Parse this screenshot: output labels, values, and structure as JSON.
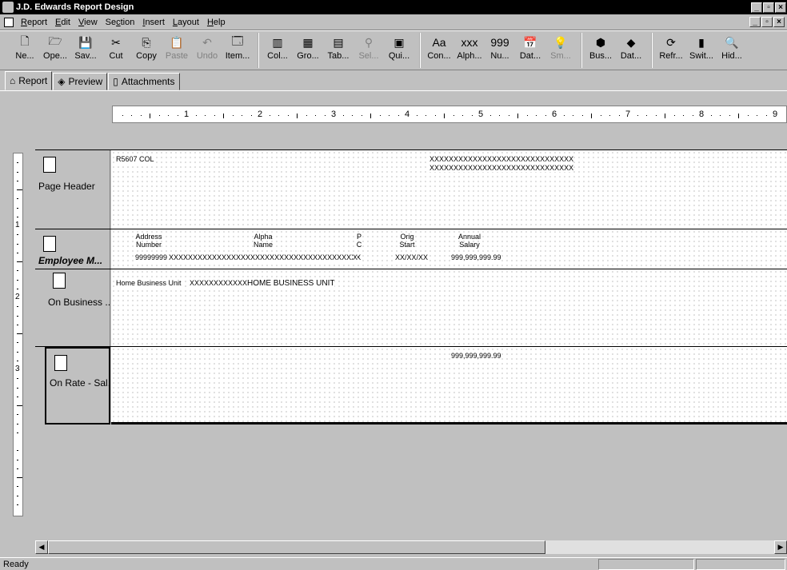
{
  "window": {
    "title": "J.D. Edwards Report Design"
  },
  "menu": [
    {
      "label": "Report",
      "key": "R"
    },
    {
      "label": "Edit",
      "key": "E"
    },
    {
      "label": "View",
      "key": "V"
    },
    {
      "label": "Section",
      "key": "c"
    },
    {
      "label": "Insert",
      "key": "I"
    },
    {
      "label": "Layout",
      "key": "L"
    },
    {
      "label": "Help",
      "key": "H"
    }
  ],
  "toolbar": {
    "groups": [
      [
        {
          "label": "Ne...",
          "icon": "new-icon",
          "glyph": "🗋",
          "enabled": true
        },
        {
          "label": "Ope...",
          "icon": "open-icon",
          "glyph": "🗁",
          "enabled": true
        },
        {
          "label": "Sav...",
          "icon": "save-icon",
          "glyph": "💾",
          "enabled": true
        },
        {
          "label": "Cut",
          "icon": "cut-icon",
          "glyph": "✂",
          "enabled": true
        },
        {
          "label": "Copy",
          "icon": "copy-icon",
          "glyph": "⎘",
          "enabled": true
        },
        {
          "label": "Paste",
          "icon": "paste-icon",
          "glyph": "📋",
          "enabled": false
        },
        {
          "label": "Undo",
          "icon": "undo-icon",
          "glyph": "↶",
          "enabled": false
        },
        {
          "label": "Item...",
          "icon": "item-properties-icon",
          "glyph": "🗔",
          "enabled": true
        }
      ],
      [
        {
          "label": "Col...",
          "icon": "columnar-section-icon",
          "glyph": "▥",
          "enabled": true
        },
        {
          "label": "Gro...",
          "icon": "group-section-icon",
          "glyph": "▦",
          "enabled": true
        },
        {
          "label": "Tab...",
          "icon": "tabular-section-icon",
          "glyph": "▤",
          "enabled": true
        },
        {
          "label": "Sel...",
          "icon": "selection-icon",
          "glyph": "⚲",
          "enabled": false
        },
        {
          "label": "Qui...",
          "icon": "quick-section-icon",
          "glyph": "▣",
          "enabled": true
        }
      ],
      [
        {
          "label": "Con...",
          "icon": "constant-icon",
          "glyph": "Aa",
          "enabled": true
        },
        {
          "label": "Alph...",
          "icon": "alpha-variable-icon",
          "glyph": "xxx",
          "enabled": true
        },
        {
          "label": "Nu...",
          "icon": "numeric-variable-icon",
          "glyph": "999",
          "enabled": true
        },
        {
          "label": "Dat...",
          "icon": "date-variable-icon",
          "glyph": "📅",
          "enabled": true
        },
        {
          "label": "Sm...",
          "icon": "smart-field-icon",
          "glyph": "💡",
          "enabled": false
        }
      ],
      [
        {
          "label": "Bus...",
          "icon": "business-view-icon",
          "glyph": "⬢",
          "enabled": true
        },
        {
          "label": "Dat...",
          "icon": "data-structure-icon",
          "glyph": "◆",
          "enabled": true
        }
      ],
      [
        {
          "label": "Refr...",
          "icon": "refresh-icon",
          "glyph": "⟳",
          "enabled": true
        },
        {
          "label": "Swit...",
          "icon": "switch-icon",
          "glyph": "▮",
          "enabled": true
        },
        {
          "label": "Hid...",
          "icon": "hide-icon",
          "glyph": "🔍",
          "enabled": true
        }
      ]
    ]
  },
  "tabs": [
    {
      "label": "Report",
      "icon": "report-tab-icon",
      "active": true
    },
    {
      "label": "Preview",
      "icon": "preview-tab-icon",
      "active": false
    },
    {
      "label": "Attachments",
      "icon": "attachments-tab-icon",
      "active": false
    }
  ],
  "ruler": {
    "numbers": [
      "1",
      "2",
      "3",
      "4",
      "5",
      "6",
      "7",
      "8",
      "9"
    ]
  },
  "vruler": {
    "numbers": [
      "1",
      "2",
      "3"
    ]
  },
  "sections": {
    "page_header": {
      "label": "Page Header",
      "report_id": "R5607 COL",
      "title_line1": "XXXXXXXXXXXXXXXXXXXXXXXXXXXXXX",
      "title_line2": "XXXXXXXXXXXXXXXXXXXXXXXXXXXXXX"
    },
    "employee_master": {
      "label": "Employee M...",
      "columns": [
        {
          "line1": "Address",
          "line2": "Number",
          "value": "99999999"
        },
        {
          "line1": "Alpha",
          "line2": "Name",
          "value": "XXXXXXXXXXXXXXXXXXXXXXXXXXXXXXXXXXXXXXXX"
        },
        {
          "line1": "P",
          "line2": "C",
          "value": "X"
        },
        {
          "line1": "Orig",
          "line2": "Start",
          "value": "XX/XX/XX"
        },
        {
          "line1": "Annual",
          "line2": "Salary",
          "value": "999,999,999.99"
        }
      ]
    },
    "on_business": {
      "label": "On Business ...",
      "constant": "Home Business Unit",
      "value": "XXXXXXXXXXXX",
      "desc": "HOME BUSINESS UNIT"
    },
    "on_rate": {
      "label": "On Rate - Sal...",
      "total": "999,999,999.99"
    }
  },
  "status": {
    "text": "Ready"
  }
}
